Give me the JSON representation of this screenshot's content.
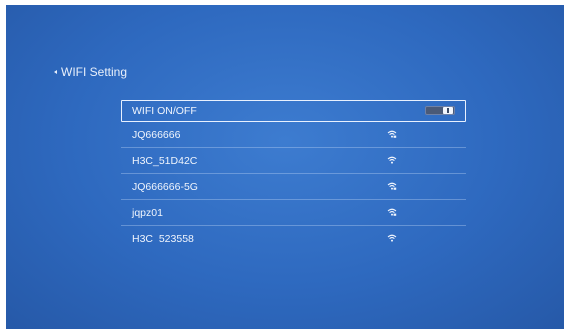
{
  "header": {
    "title": "WIFI Setting"
  },
  "wifi_list": {
    "toggle_row": {
      "label": "WIFI ON/OFF",
      "state": "on"
    },
    "networks": [
      {
        "ssid": "JQ666666",
        "secured": true
      },
      {
        "ssid": "H3C_51D42C",
        "secured": false
      },
      {
        "ssid": "JQ666666-5G",
        "secured": true
      },
      {
        "ssid": "jqpz01",
        "secured": true
      },
      {
        "ssid": "H3C_523558",
        "secured": false
      }
    ]
  },
  "colors": {
    "background": "#2e69bf",
    "text": "#f0f5fd",
    "selection_border": "#e8f1ff"
  },
  "icons": {
    "back": "chevron-left-icon",
    "wifi": "wifi-signal-icon",
    "toggle": "toggle-switch-icon"
  }
}
